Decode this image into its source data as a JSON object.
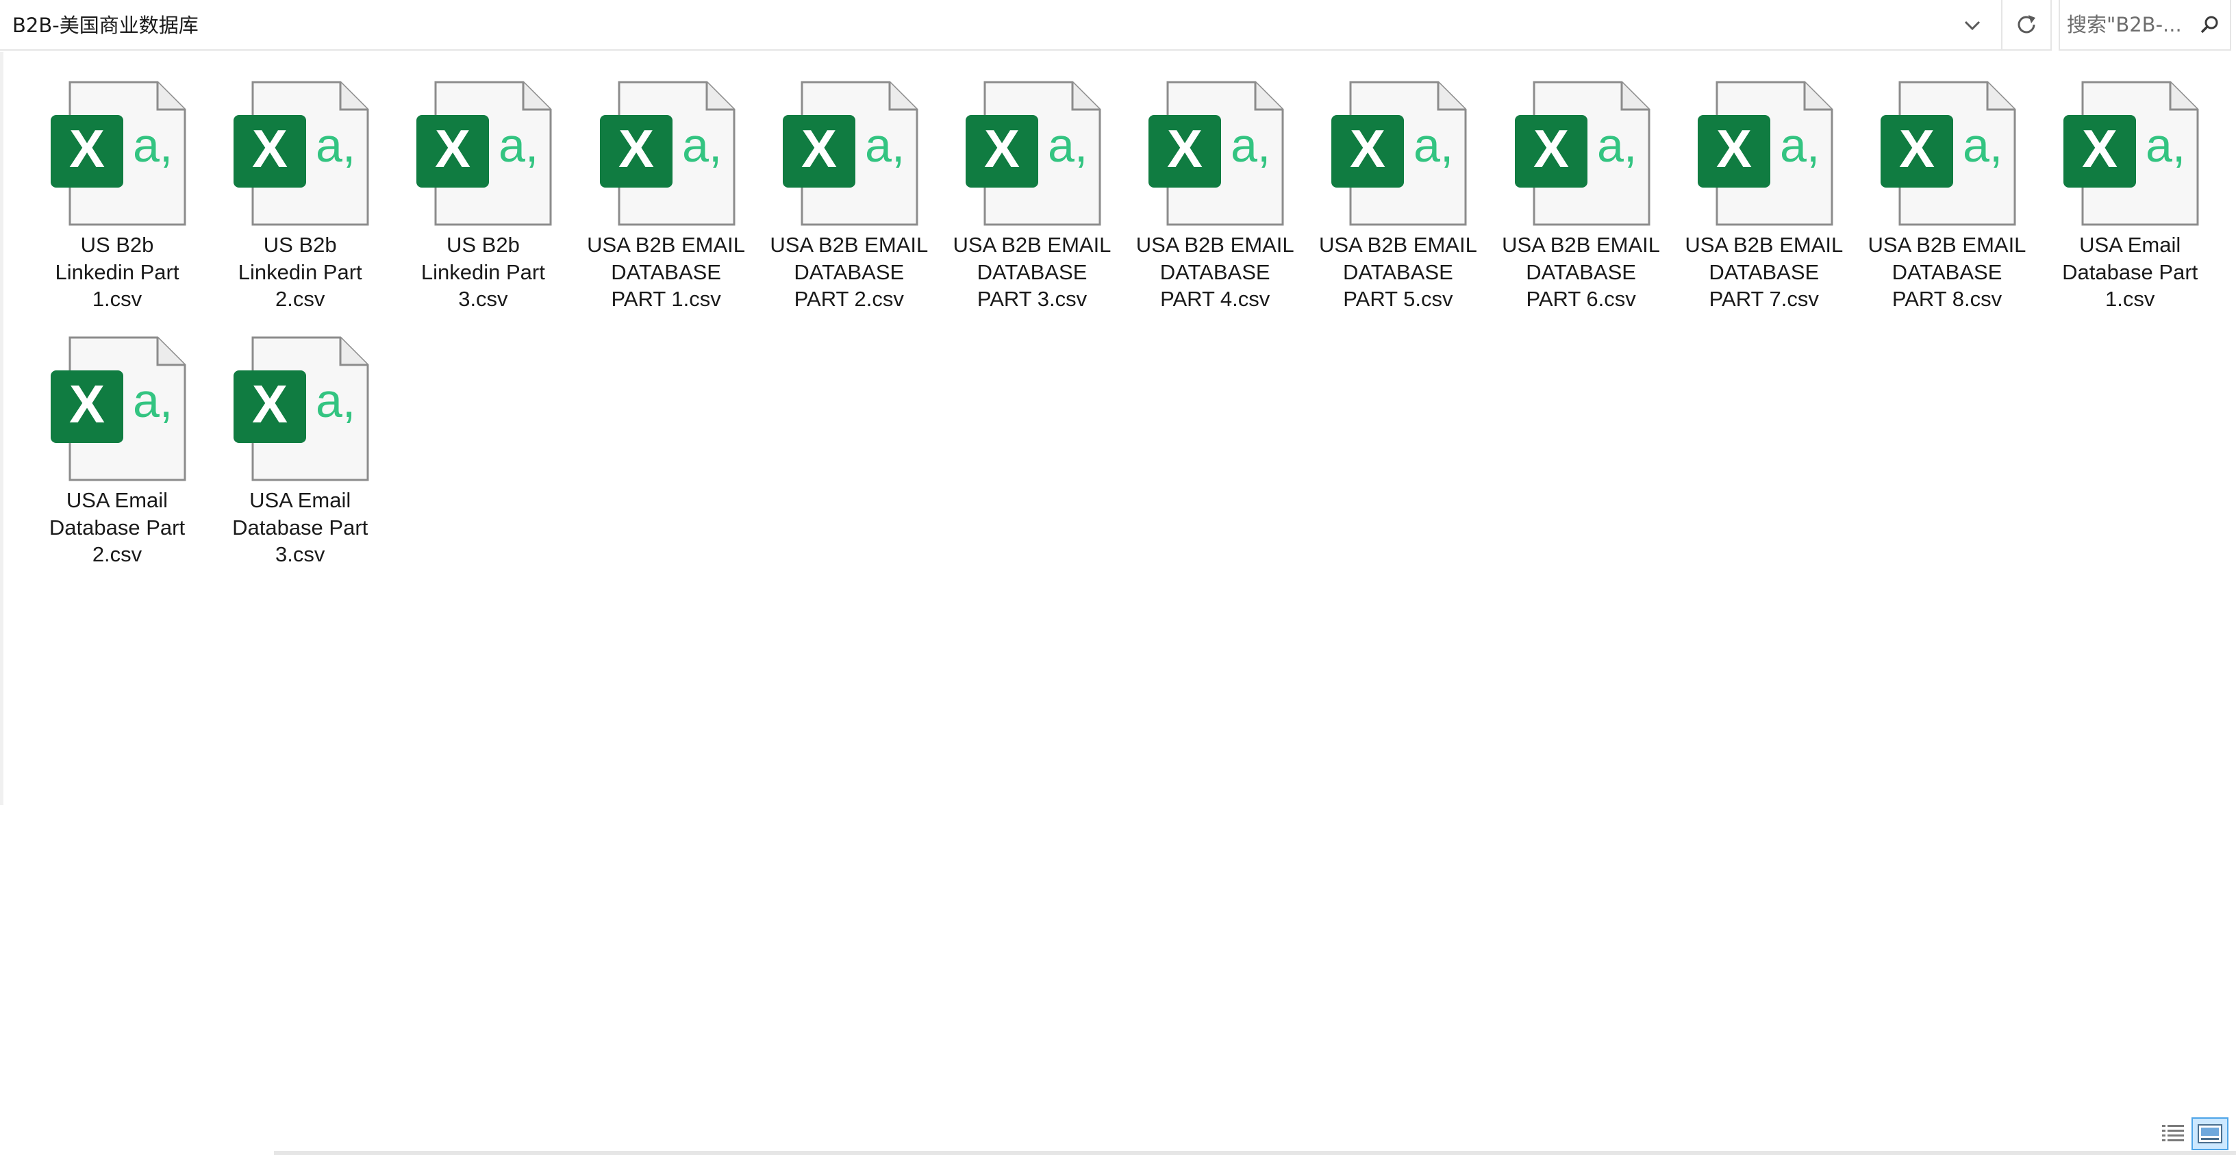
{
  "address_bar": {
    "path": "B2B-美国商业数据库",
    "dropdown_icon": "chevron-down-icon",
    "refresh_icon": "refresh-icon"
  },
  "search": {
    "placeholder": "搜索\"B2B-...",
    "icon": "search-icon"
  },
  "files": [
    {
      "name": "US B2b\nLinkedin Part\n1.csv",
      "type": "csv-excel-icon"
    },
    {
      "name": "US B2b\nLinkedin Part\n2.csv",
      "type": "csv-excel-icon"
    },
    {
      "name": "US B2b\nLinkedin Part\n3.csv",
      "type": "csv-excel-icon"
    },
    {
      "name": "USA B2B EMAIL\nDATABASE\nPART 1.csv",
      "type": "csv-excel-icon"
    },
    {
      "name": "USA B2B EMAIL\nDATABASE\nPART 2.csv",
      "type": "csv-excel-icon"
    },
    {
      "name": "USA B2B EMAIL\nDATABASE\nPART 3.csv",
      "type": "csv-excel-icon"
    },
    {
      "name": "USA B2B EMAIL\nDATABASE\nPART 4.csv",
      "type": "csv-excel-icon"
    },
    {
      "name": "USA B2B EMAIL\nDATABASE\nPART 5.csv",
      "type": "csv-excel-icon"
    },
    {
      "name": "USA B2B EMAIL\nDATABASE\nPART 6.csv",
      "type": "csv-excel-icon"
    },
    {
      "name": "USA B2B EMAIL\nDATABASE\nPART 7.csv",
      "type": "csv-excel-icon"
    },
    {
      "name": "USA B2B EMAIL\nDATABASE\nPART 8.csv",
      "type": "csv-excel-icon"
    },
    {
      "name": "USA Email\nDatabase Part\n1.csv",
      "type": "csv-excel-icon"
    },
    {
      "name": "USA Email\nDatabase Part\n2.csv",
      "type": "csv-excel-icon"
    },
    {
      "name": "USA Email\nDatabase Part\n3.csv",
      "type": "csv-excel-icon"
    }
  ],
  "icon_text": {
    "x_letter": "X",
    "a_letter": "a,"
  },
  "status_bar": {
    "details_view_icon": "details-view-icon",
    "large_icons_view_icon": "large-icons-view-icon"
  },
  "colors": {
    "excel_green": "#107c41",
    "excel_light_green": "#33c481",
    "selected_view_bg": "#cce8ff",
    "selected_view_border": "#4ea5e8"
  }
}
